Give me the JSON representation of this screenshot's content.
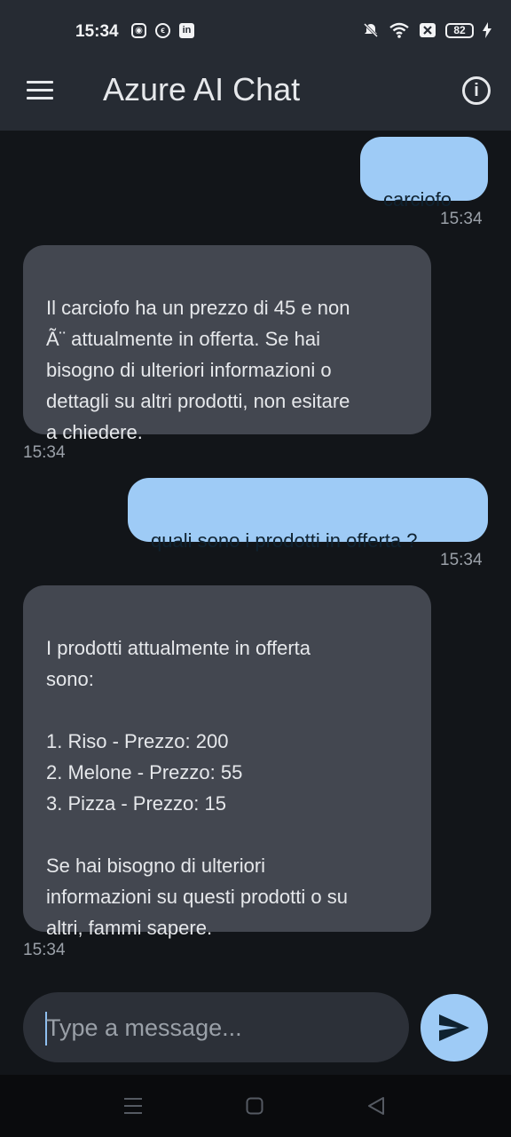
{
  "status_bar": {
    "time": "15:34",
    "left_icons": [
      "instagram-icon",
      "messenger-icon",
      "linkedin-icon"
    ],
    "right_icons": [
      "mute-icon",
      "wifi-icon",
      "sim-icon"
    ],
    "battery": "82"
  },
  "app_bar": {
    "title": "Azure AI Chat"
  },
  "messages": [
    {
      "role": "user",
      "text": "carciofo",
      "time": "15:34"
    },
    {
      "role": "assistant",
      "text": "Il carciofo ha un prezzo di 45 e non\nÃ¨ attualmente in offerta. Se hai\nbisogno di ulteriori informazioni o\ndettagli su altri prodotti, non esitare\na chiedere.",
      "time": "15:34"
    },
    {
      "role": "user",
      "text": "quali sono i prodotti in offerta ?",
      "time": "15:34"
    },
    {
      "role": "assistant",
      "text": "I prodotti attualmente in offerta\nsono:\n\n1. Riso - Prezzo: 200\n2. Melone - Prezzo: 55\n3. Pizza - Prezzo: 15\n\nSe hai bisogno di ulteriori\ninformazioni su questi prodotti o su\naltri, fammi sapere.",
      "time": "15:34"
    }
  ],
  "composer": {
    "placeholder": "Type a message...",
    "value": ""
  },
  "colors": {
    "user_bubble": "#9ecbf6",
    "bot_bubble": "#434750",
    "background": "#121519"
  }
}
